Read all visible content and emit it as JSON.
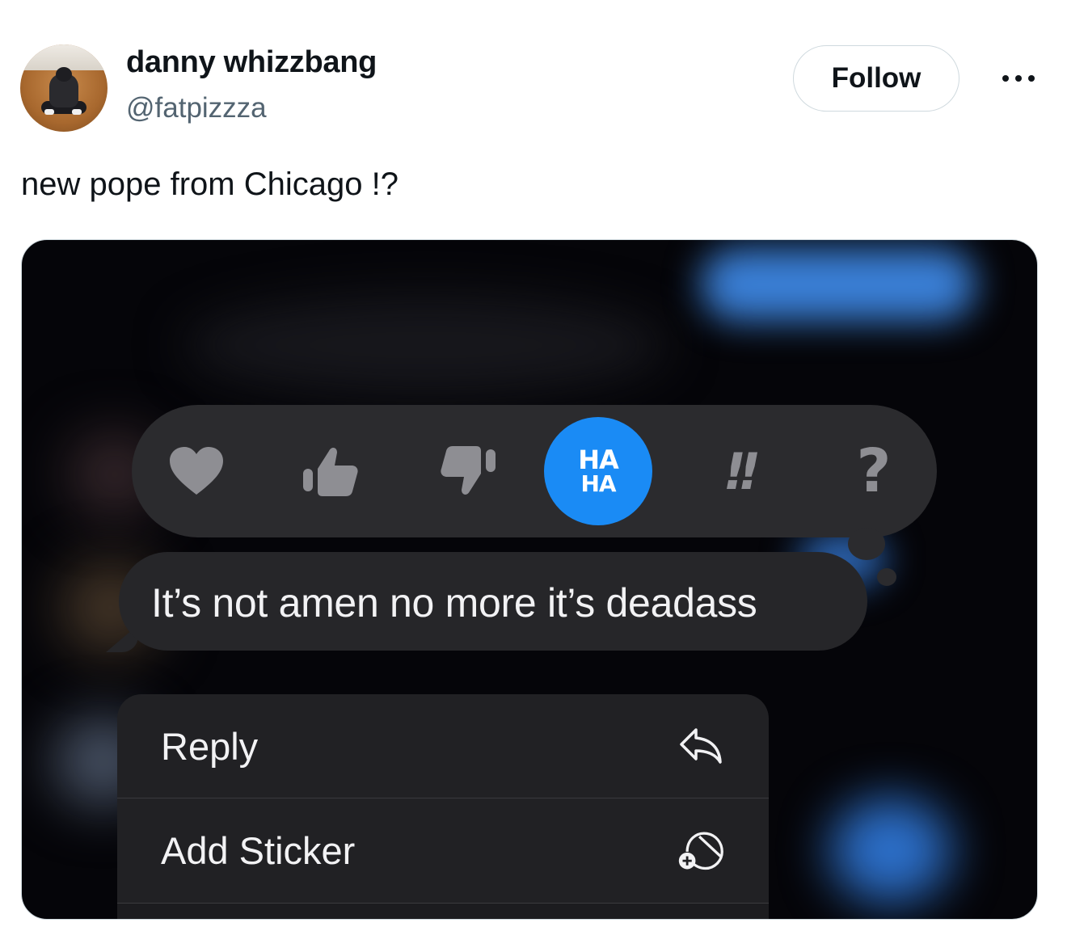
{
  "author": {
    "display_name": "danny whizzbang",
    "handle": "@fatpizzza"
  },
  "actions": {
    "follow_label": "Follow",
    "more_icon": "more-horizontal-icon"
  },
  "tweet": {
    "text": "new pope from Chicago !?"
  },
  "screenshot": {
    "reactions": [
      {
        "icon": "heart-icon"
      },
      {
        "icon": "thumbs-up-icon"
      },
      {
        "icon": "thumbs-down-icon"
      },
      {
        "icon": "haha-icon",
        "line1": "HA",
        "line2": "HA",
        "selected": true
      },
      {
        "icon": "exclamation-icon",
        "text": "!!"
      },
      {
        "icon": "question-icon",
        "text": "?"
      }
    ],
    "message": "It’s not amen no more it’s deadass",
    "menu": [
      {
        "label": "Reply",
        "icon": "reply-icon"
      },
      {
        "label": "Add Sticker",
        "icon": "add-sticker-icon"
      }
    ]
  },
  "colors": {
    "haha_accent": "#1a8bf5",
    "reaction_icon": "#8e8e93",
    "follow_border": "#cfd9de",
    "secondary_text": "#536471"
  }
}
